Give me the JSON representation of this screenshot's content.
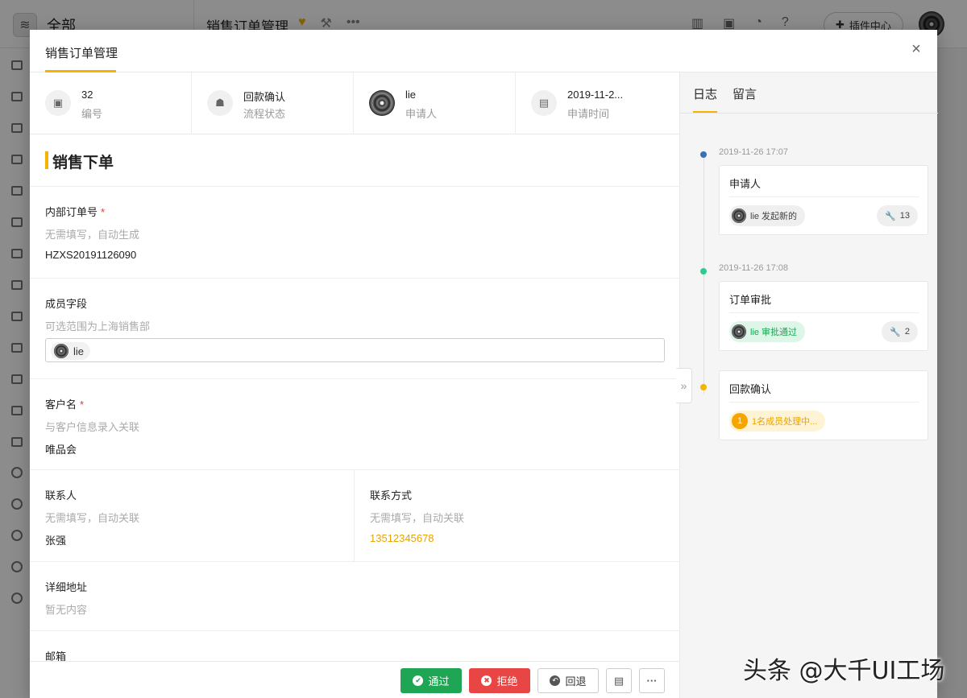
{
  "background": {
    "workspace_label": "全部",
    "app_title": "销售订单管理",
    "plugin_button": "插件中心"
  },
  "modal": {
    "title": "销售订单管理",
    "close_icon": "close-icon"
  },
  "info": [
    {
      "value": "32",
      "label": "编号",
      "icon": "id-icon"
    },
    {
      "value": "回款确认",
      "label": "流程状态",
      "icon": "flow-icon"
    },
    {
      "value": "lie",
      "label": "申请人",
      "icon": "avatar"
    },
    {
      "value": "2019-11-2...",
      "label": "申请时间",
      "icon": "calendar-icon"
    }
  ],
  "section_title": "销售下单",
  "fields": {
    "order_no": {
      "label": "内部订单号",
      "required": "*",
      "hint": "无需填写，自动生成",
      "value": "HZXS20191126090"
    },
    "member": {
      "label": "成员字段",
      "hint": "可选范围为上海销售部",
      "value": "lie"
    },
    "customer": {
      "label": "客户名",
      "required": "*",
      "hint": "与客户信息录入关联",
      "value": "唯品会"
    },
    "contact": {
      "label": "联系人",
      "hint": "无需填写，自动关联",
      "value": "张强"
    },
    "contact_method": {
      "label": "联系方式",
      "hint": "无需填写，自动关联",
      "value": "13512345678"
    },
    "address": {
      "label": "详细地址",
      "hint": "暂无内容"
    },
    "email": {
      "label": "邮箱"
    }
  },
  "footer": {
    "pass": "通过",
    "reject": "拒绝",
    "back": "回退"
  },
  "right_panel": {
    "tabs": [
      "日志",
      "留言"
    ],
    "timeline": [
      {
        "time": "2019-11-26 17:07",
        "title": "申请人",
        "pill": "lie 发起新的",
        "count": "13",
        "dot_color": "#3b6fb6"
      },
      {
        "time": "2019-11-26 17:08",
        "title": "订单审批",
        "pill": "lie 审批通过",
        "count": "2",
        "dot_color": "#2ecc8f"
      },
      {
        "title": "回款确认",
        "pill_num": "1",
        "pill": "1名成员处理中...",
        "dot_color": "#f5b400"
      }
    ]
  },
  "watermark": "头条 @大千UI工场"
}
